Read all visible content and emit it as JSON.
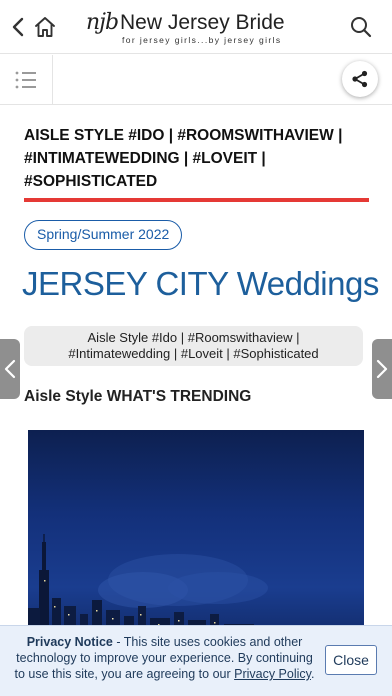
{
  "header": {
    "logo_mark": "njb",
    "logo_title": "New Jersey Bride",
    "logo_tagline": "for jersey girls...by jersey girls"
  },
  "article": {
    "headline": "AISLE STYLE #IDO | #ROOMSWITHAVIEW | #INTIMATEWEDDING | #LOVEIT | #SOPHISTICATED",
    "season": "Spring/Summer 2022",
    "title": "JERSEY CITY Weddings",
    "tags_line1": "Aisle Style #Ido | #Roomswithaview |",
    "tags_line2": "#Intimatewedding | #Loveit | #Sophisticated",
    "section_heading": "Aisle Style WHAT'S TRENDING"
  },
  "privacy": {
    "label": "Privacy Notice",
    "text_before": " - This site uses cookies and other technology to improve your experience. By continuing to use this site, you are agreeing to our ",
    "link": "Privacy Policy",
    "text_after": ".",
    "close_label": "Close"
  },
  "colors": {
    "accent_blue": "#1d5f9c",
    "rule_red": "#e53935",
    "privacy_bg": "#e9f0fa"
  },
  "icons": {
    "back": "chevron-left-icon",
    "home": "home-icon",
    "search": "search-icon",
    "menu": "list-menu-icon",
    "share": "share-icon",
    "prev": "chevron-left-icon",
    "next": "chevron-right-icon"
  }
}
